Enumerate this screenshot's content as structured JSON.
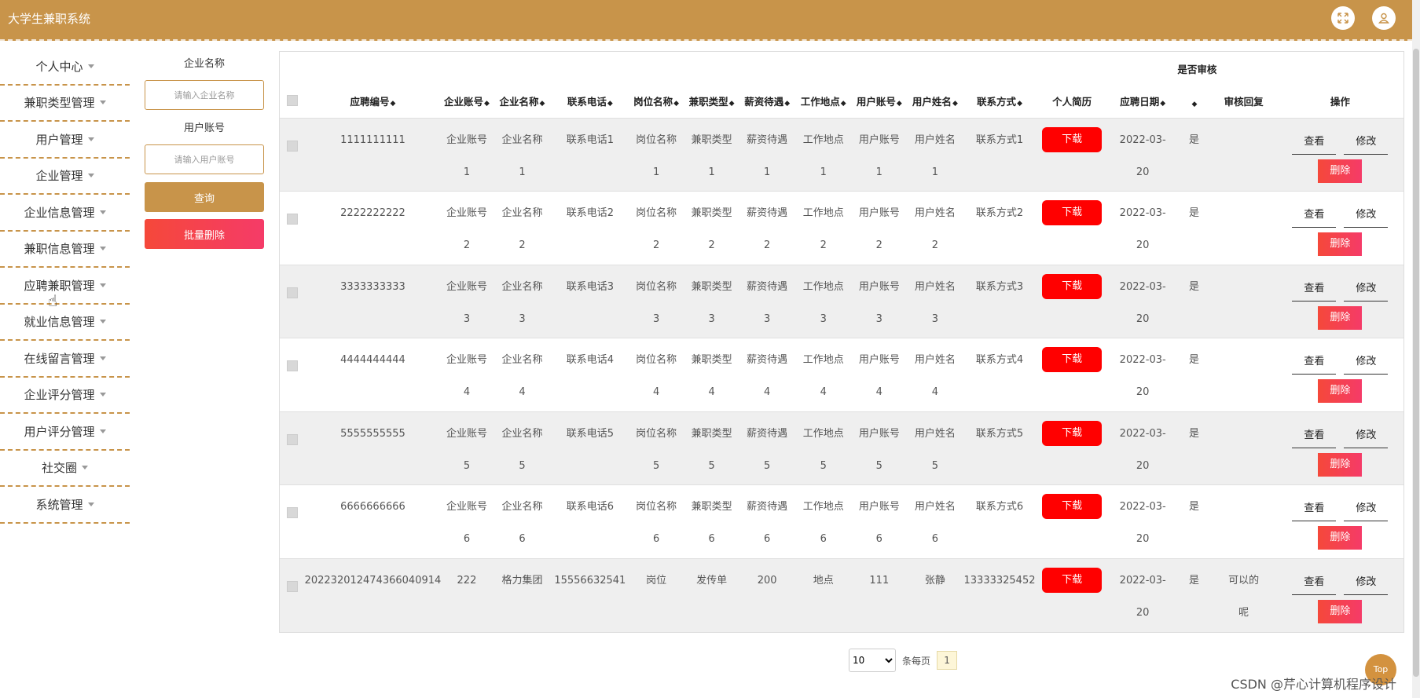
{
  "app": {
    "title": "大学生兼职系统"
  },
  "header": {
    "icons": [
      "fullscreen-icon",
      "user-icon"
    ]
  },
  "sidebar": {
    "items": [
      {
        "label": "个人中心"
      },
      {
        "label": "兼职类型管理"
      },
      {
        "label": "用户管理"
      },
      {
        "label": "企业管理"
      },
      {
        "label": "企业信息管理"
      },
      {
        "label": "兼职信息管理"
      },
      {
        "label": "应聘兼职管理"
      },
      {
        "label": "就业信息管理"
      },
      {
        "label": "在线留言管理"
      },
      {
        "label": "企业评分管理"
      },
      {
        "label": "用户评分管理"
      },
      {
        "label": "社交圈"
      },
      {
        "label": "系统管理"
      }
    ]
  },
  "filter": {
    "company_label": "企业名称",
    "company_placeholder": "请输入企业名称",
    "account_label": "用户账号",
    "account_placeholder": "请输入用户账号",
    "query_label": "查询",
    "batch_delete_label": "批量删除"
  },
  "table": {
    "audit_group_header": "是否审核",
    "columns": [
      "应聘编号",
      "企业账号",
      "企业名称",
      "联系电话",
      "岗位名称",
      "兼职类型",
      "薪资待遇",
      "工作地点",
      "用户账号",
      "用户姓名",
      "联系方式",
      "个人简历",
      "应聘日期",
      "",
      "审核回复",
      "操作"
    ],
    "download_label": "下载",
    "view_label": "查看",
    "edit_label": "修改",
    "delete_label": "删除",
    "rows": [
      {
        "id": "1111111111",
        "company_account": [
          "企业账号",
          "1"
        ],
        "company_name": [
          "企业名称",
          "1"
        ],
        "phone": "联系电话1",
        "job": [
          "岗位名称",
          "1"
        ],
        "type": [
          "兼职类型",
          "1"
        ],
        "salary": [
          "薪资待遇",
          "1"
        ],
        "place": [
          "工作地点",
          "1"
        ],
        "user_account": [
          "用户账号",
          "1"
        ],
        "user_name": [
          "用户姓名",
          "1"
        ],
        "contact": "联系方式1",
        "date": [
          "2022-03-",
          "20"
        ],
        "audit": "是",
        "reply": [
          "",
          ""
        ]
      },
      {
        "id": "2222222222",
        "company_account": [
          "企业账号",
          "2"
        ],
        "company_name": [
          "企业名称",
          "2"
        ],
        "phone": "联系电话2",
        "job": [
          "岗位名称",
          "2"
        ],
        "type": [
          "兼职类型",
          "2"
        ],
        "salary": [
          "薪资待遇",
          "2"
        ],
        "place": [
          "工作地点",
          "2"
        ],
        "user_account": [
          "用户账号",
          "2"
        ],
        "user_name": [
          "用户姓名",
          "2"
        ],
        "contact": "联系方式2",
        "date": [
          "2022-03-",
          "20"
        ],
        "audit": "是",
        "reply": [
          "",
          ""
        ]
      },
      {
        "id": "3333333333",
        "company_account": [
          "企业账号",
          "3"
        ],
        "company_name": [
          "企业名称",
          "3"
        ],
        "phone": "联系电话3",
        "job": [
          "岗位名称",
          "3"
        ],
        "type": [
          "兼职类型",
          "3"
        ],
        "salary": [
          "薪资待遇",
          "3"
        ],
        "place": [
          "工作地点",
          "3"
        ],
        "user_account": [
          "用户账号",
          "3"
        ],
        "user_name": [
          "用户姓名",
          "3"
        ],
        "contact": "联系方式3",
        "date": [
          "2022-03-",
          "20"
        ],
        "audit": "是",
        "reply": [
          "",
          ""
        ]
      },
      {
        "id": "4444444444",
        "company_account": [
          "企业账号",
          "4"
        ],
        "company_name": [
          "企业名称",
          "4"
        ],
        "phone": "联系电话4",
        "job": [
          "岗位名称",
          "4"
        ],
        "type": [
          "兼职类型",
          "4"
        ],
        "salary": [
          "薪资待遇",
          "4"
        ],
        "place": [
          "工作地点",
          "4"
        ],
        "user_account": [
          "用户账号",
          "4"
        ],
        "user_name": [
          "用户姓名",
          "4"
        ],
        "contact": "联系方式4",
        "date": [
          "2022-03-",
          "20"
        ],
        "audit": "是",
        "reply": [
          "",
          ""
        ]
      },
      {
        "id": "5555555555",
        "company_account": [
          "企业账号",
          "5"
        ],
        "company_name": [
          "企业名称",
          "5"
        ],
        "phone": "联系电话5",
        "job": [
          "岗位名称",
          "5"
        ],
        "type": [
          "兼职类型",
          "5"
        ],
        "salary": [
          "薪资待遇",
          "5"
        ],
        "place": [
          "工作地点",
          "5"
        ],
        "user_account": [
          "用户账号",
          "5"
        ],
        "user_name": [
          "用户姓名",
          "5"
        ],
        "contact": "联系方式5",
        "date": [
          "2022-03-",
          "20"
        ],
        "audit": "是",
        "reply": [
          "",
          ""
        ]
      },
      {
        "id": "6666666666",
        "company_account": [
          "企业账号",
          "6"
        ],
        "company_name": [
          "企业名称",
          "6"
        ],
        "phone": "联系电话6",
        "job": [
          "岗位名称",
          "6"
        ],
        "type": [
          "兼职类型",
          "6"
        ],
        "salary": [
          "薪资待遇",
          "6"
        ],
        "place": [
          "工作地点",
          "6"
        ],
        "user_account": [
          "用户账号",
          "6"
        ],
        "user_name": [
          "用户姓名",
          "6"
        ],
        "contact": "联系方式6",
        "date": [
          "2022-03-",
          "20"
        ],
        "audit": "是",
        "reply": [
          "",
          ""
        ]
      },
      {
        "id": "20223201247436604091​4",
        "company_account": [
          "222",
          ""
        ],
        "company_name": [
          "格力集团",
          ""
        ],
        "phone": "15556632541",
        "job": [
          "岗位",
          ""
        ],
        "type": [
          "发传单",
          ""
        ],
        "salary": [
          "200",
          ""
        ],
        "place": [
          "地点",
          ""
        ],
        "user_account": [
          "111",
          ""
        ],
        "user_name": [
          "张静",
          ""
        ],
        "contact": "13333325452",
        "date": [
          "2022-03-",
          "20"
        ],
        "audit": "是",
        "reply": [
          "可以的",
          "呢"
        ]
      }
    ]
  },
  "pager": {
    "page_size": "10",
    "page_size_options": [
      "10"
    ],
    "per_page_label": "条每页",
    "current_page": "1"
  },
  "top_button": "Top",
  "watermark": "CSDN @芹心计算机程序设计",
  "colors": {
    "brand": "#c8944a",
    "danger": "#ff0000",
    "delete_gradient_start": "#f5483a",
    "delete_gradient_end": "#f53b68"
  }
}
